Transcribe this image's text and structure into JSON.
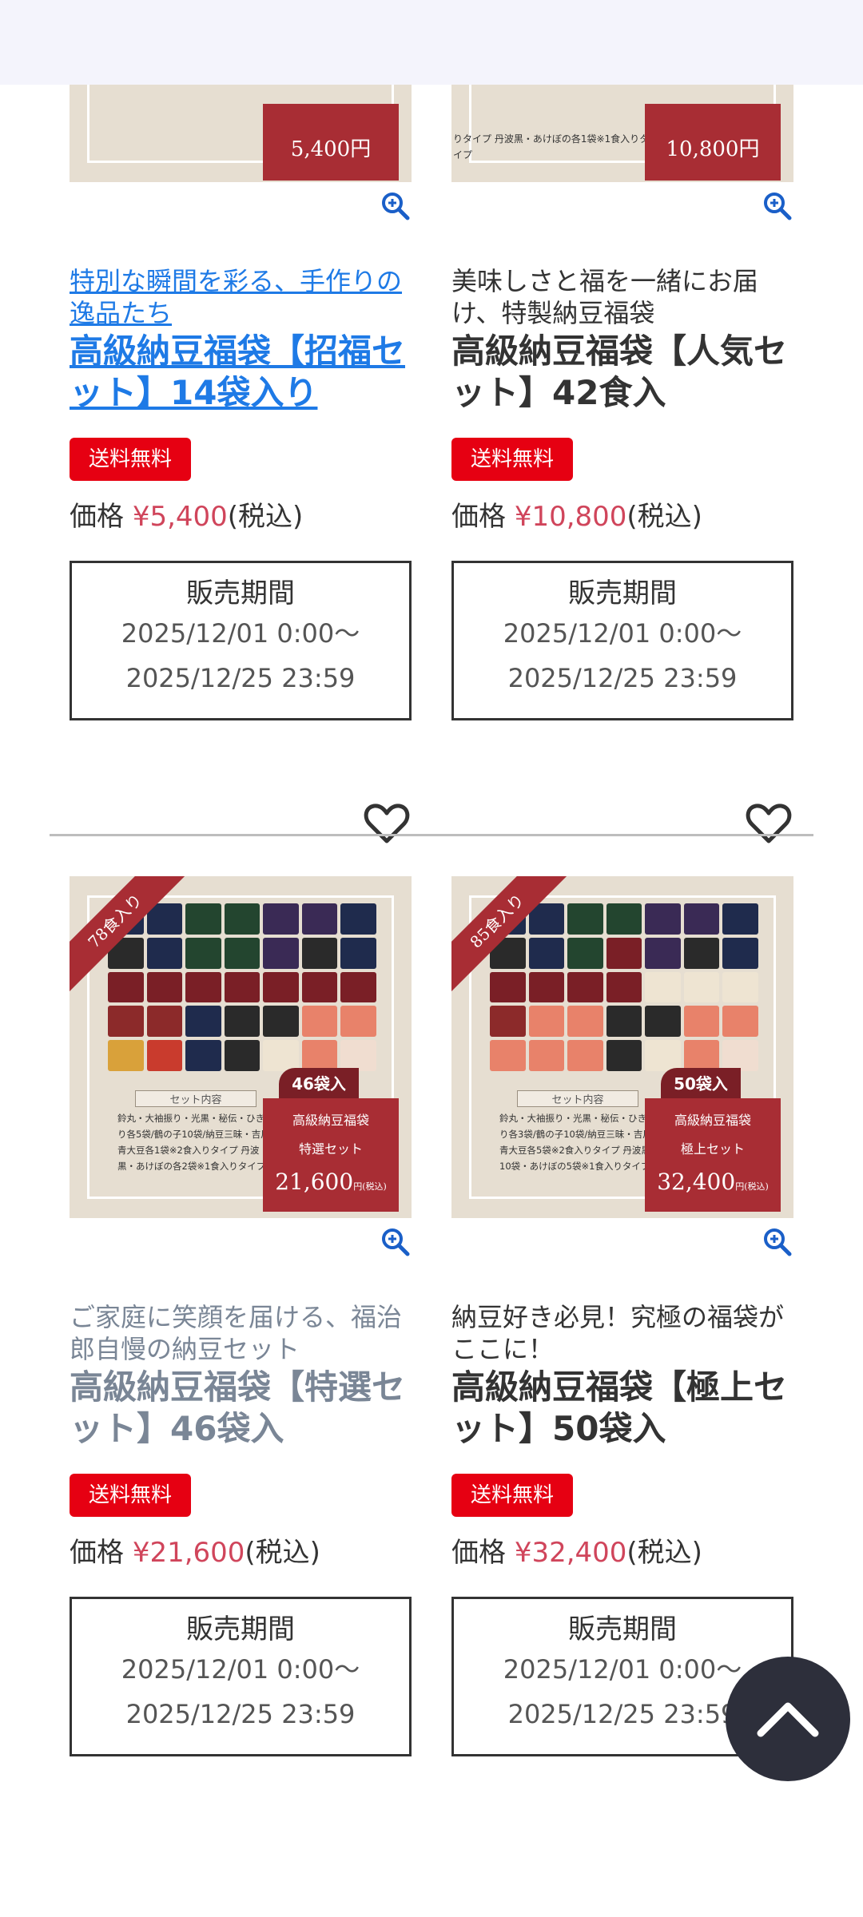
{
  "products": [
    {
      "catch": "特別な瞬間を彩る、手作りの逸品たち",
      "name": "高級納豆福袋【招福セット】14袋入り",
      "free_shipping": "送料無料",
      "price_label": "価格",
      "price_value": "¥5,400",
      "price_tax": "(税込)",
      "period_title": "販売期間",
      "period_start": "2025/12/01 0:00〜",
      "period_end": "2025/12/25 23:59",
      "image_price": "5,400円",
      "style": "link"
    },
    {
      "catch": "美味しさと福を一緒にお届け、特製納豆福袋",
      "name": "高級納豆福袋【人気セット】42食入",
      "free_shipping": "送料無料",
      "price_label": "価格",
      "price_value": "¥10,800",
      "price_tax": "(税込)",
      "period_title": "販売期間",
      "period_start": "2025/12/01 0:00〜",
      "period_end": "2025/12/25 23:59",
      "image_text": "りタイプ 丹波黒・あけぼの各1袋※1食入りタイプ",
      "image_price": "10,800円",
      "style": "dark"
    },
    {
      "catch": "ご家庭に笑顔を届ける、福治郎自慢の納豆セット",
      "name": "高級納豆福袋【特選セット】46袋入",
      "free_shipping": "送料無料",
      "price_label": "価格",
      "price_value": "¥21,600",
      "price_tax": "(税込)",
      "period_title": "販売期間",
      "period_start": "2025/12/01 0:00〜",
      "period_end": "2025/12/25 23:59",
      "image_ribbon": "78食入り",
      "image_count": "46袋入",
      "image_contents_title": "セット内容",
      "image_contents": "鈴丸・大袖振り・光黒・秘伝・ひきわり各5袋/鶴の子10袋/納豆三昧・吉川青大豆各1袋※2食入りタイプ 丹波黒・あけぼの各2袋※1食入りタイプ",
      "image_name": "高級納豆福袋",
      "image_set": "特選セット",
      "image_price": "21,600",
      "image_price_unit": "円",
      "image_tax": "(税込)",
      "style": "muted"
    },
    {
      "catch": "納豆好き必見！究極の福袋がここに！",
      "name": "高級納豆福袋【極上セット】50袋入",
      "free_shipping": "送料無料",
      "price_label": "価格",
      "price_value": "¥32,400",
      "price_tax": "(税込)",
      "period_title": "販売期間",
      "period_start": "2025/12/01 0:00〜",
      "period_end": "2025/12/25 23:59",
      "image_ribbon": "85食入り",
      "image_count": "50袋入",
      "image_contents_title": "セット内容",
      "image_contents": "鈴丸・大袖振り・光黒・秘伝・ひきわり各3袋/鶴の子10袋/納豆三昧・吉川青大豆各5袋※2食入りタイプ 丹波黒10袋・あけぼの5袋※1食入りタイプ",
      "image_name": "高級納豆福袋",
      "image_set": "極上セット",
      "image_price": "32,400",
      "image_price_unit": "円",
      "image_tax": "(税込)",
      "style": "dark"
    }
  ],
  "icons": {
    "zoom": "zoom-in-icon",
    "favorite": "heart-outline-icon",
    "back_to_top": "chevron-up-icon"
  },
  "colors": {
    "free_shipping_bg": "#e60012",
    "price": "#d0455b",
    "link": "#1e7ae6",
    "image_accent": "#a82d34"
  }
}
